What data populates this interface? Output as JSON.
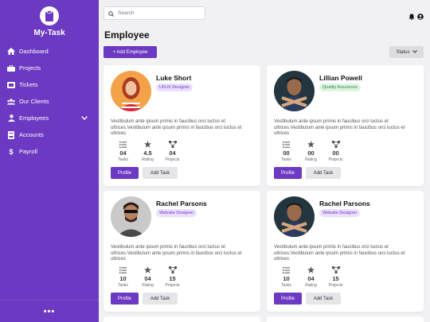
{
  "app": {
    "name": "My-Task"
  },
  "sidebar": {
    "items": [
      {
        "label": "Dashboard",
        "icon": "home-icon"
      },
      {
        "label": "Projects",
        "icon": "briefcase-icon"
      },
      {
        "label": "Tickets",
        "icon": "ticket-icon"
      },
      {
        "label": "Our Clients",
        "icon": "users-icon"
      },
      {
        "label": "Employees",
        "icon": "user-icon"
      },
      {
        "label": "Accounts",
        "icon": "receipt-icon"
      },
      {
        "label": "Payroll",
        "icon": "dollar-icon"
      }
    ],
    "more": "•••"
  },
  "search": {
    "placeholder": "Search"
  },
  "page": {
    "title": "Employee",
    "add_button": "+ Add Employee",
    "status_button": "Status"
  },
  "stat_labels": {
    "tasks": "Tasks",
    "rating": "Rating",
    "projects": "Projects"
  },
  "buttons": {
    "profile": "Profile",
    "add_task": "Add Task"
  },
  "employees": [
    {
      "name": "Luke Short",
      "role": "UI/UX Designer",
      "role_color": "purple",
      "description": "Vestibulum ante ipsum primis in faucibus orci luctus et ultrices.Vestibulum ante ipsum primis in faucibus orci luctus et ultrices",
      "tasks": "04",
      "rating": "4.5",
      "projects": "04"
    },
    {
      "name": "Lillian Powell",
      "role": "Quality Assurence",
      "role_color": "green",
      "description": "Vestibulum ante ipsum primis in faucibus orci luctus et ultrices.Vestibulum ante ipsum primis in faucibus orci luctus et ultrices",
      "tasks": "00",
      "rating": "00",
      "projects": "00"
    },
    {
      "name": "Rachel Parsons",
      "role": "Website Designer",
      "role_color": "purple",
      "description": "Vestibulum ante ipsum primis in faucibus orci luctus et ultrices.Vestibulum ante ipsum primis in faucibus orci luctus et ultrices",
      "tasks": "10",
      "rating": "04",
      "projects": "15"
    },
    {
      "name": "Rachel Parsons",
      "role": "Website Designer",
      "role_color": "purple",
      "description": "Vestibulum ante ipsum primis in faucibus orci luctus et ultrices.Vestibulum ante ipsum primis in faucibus orci luctus et ultrices",
      "tasks": "10",
      "rating": "04",
      "projects": "15"
    }
  ],
  "colors": {
    "accent": "#6c39c2",
    "background": "#f1f1f4"
  }
}
